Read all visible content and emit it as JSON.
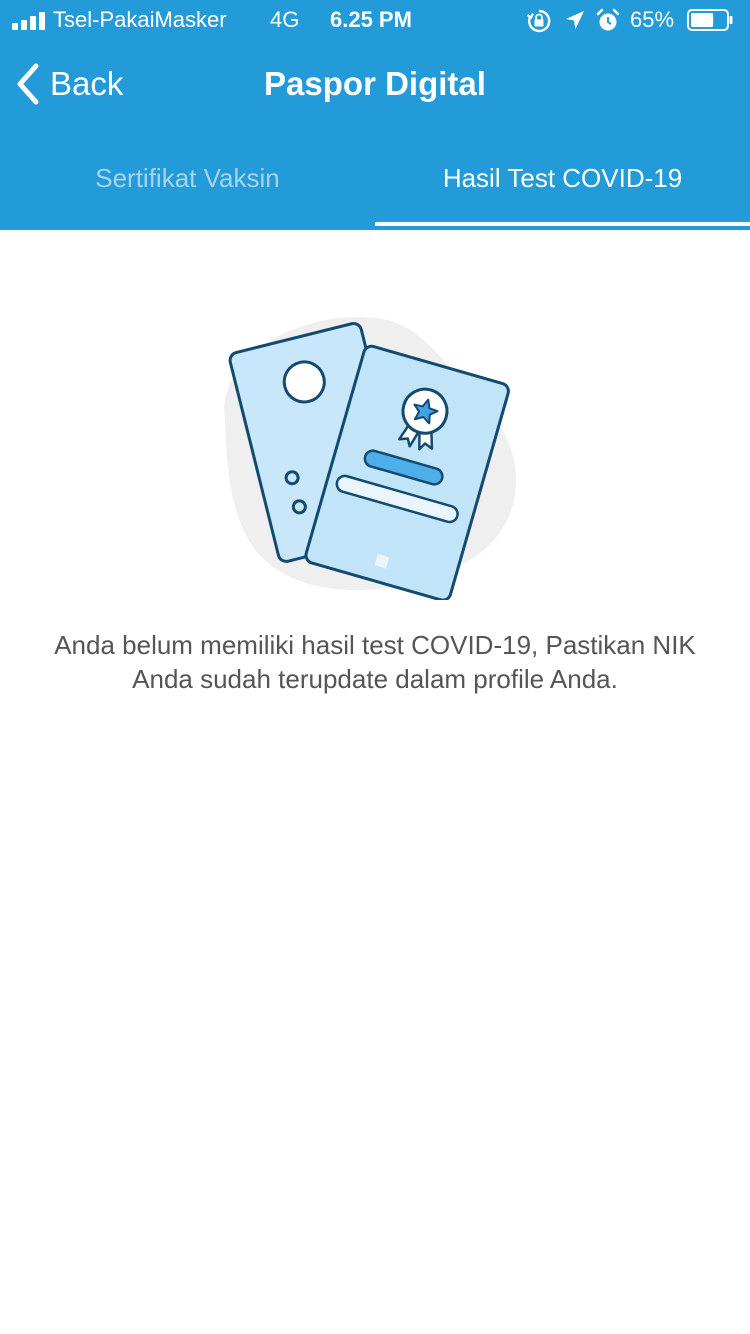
{
  "status_bar": {
    "carrier": "Tsel-PakaiMasker",
    "network": "4G",
    "time": "6.25 PM",
    "battery_percent": "65%",
    "battery_level": 0.65,
    "icons": [
      "signal-icon",
      "orientation-lock-icon",
      "location-icon",
      "alarm-icon",
      "battery-icon"
    ]
  },
  "nav": {
    "back_label": "Back",
    "title": "Paspor Digital"
  },
  "tabs": [
    {
      "label": "Sertifikat Vaksin",
      "active": false
    },
    {
      "label": "Hasil Test COVID-19",
      "active": true
    }
  ],
  "empty_state": {
    "illustration": "certificate-documents-illustration",
    "message": "Anda belum memiliki hasil test COVID-19, Pastikan NIK Anda sudah terupdate dalam profile Anda."
  },
  "colors": {
    "header": "#239BD9",
    "tab_inactive": "#A7D3EE",
    "tab_active": "#FFFFFF",
    "message_text": "#555555"
  }
}
